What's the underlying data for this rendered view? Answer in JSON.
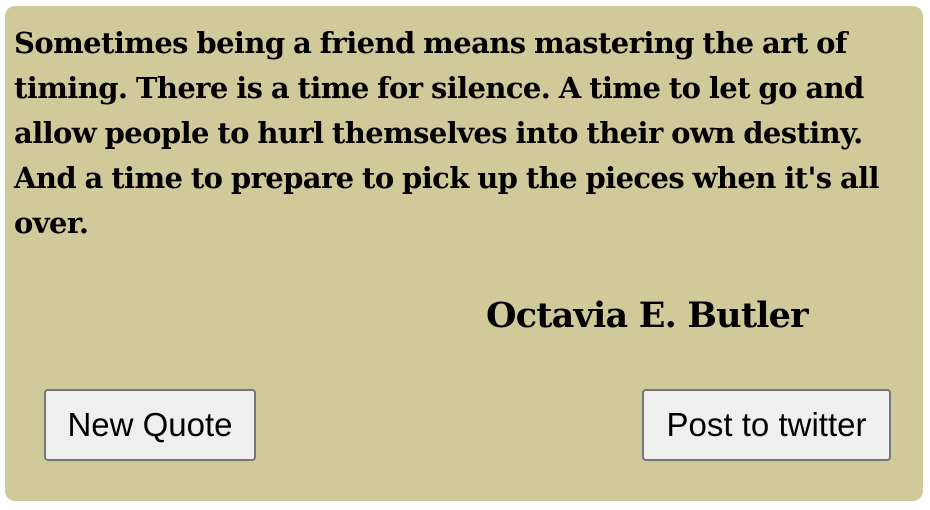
{
  "quote": {
    "text": "Sometimes being a friend means mastering the art of timing. There is a time for silence. A time to let go and allow people to hurl themselves into their own destiny. And a time to prepare to pick up the pieces when it's all over.",
    "author": "Octavia E. Butler"
  },
  "buttons": {
    "new_quote_label": "New Quote",
    "tweet_label": "Post to twitter"
  },
  "colors": {
    "card_background": "#d0ca9a",
    "button_background": "#efefef",
    "text": "#000000"
  }
}
